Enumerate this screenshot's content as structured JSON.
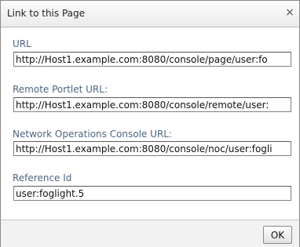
{
  "dialog": {
    "title": "Link to this Page",
    "close_glyph": "×"
  },
  "fields": {
    "url": {
      "label": "URL",
      "value": "http://Host1.example.com:8080/console/page/user:fo"
    },
    "remote_portlet_url": {
      "label": "Remote Portlet URL:",
      "value": "http://Host1.example.com:8080/console/remote/user:"
    },
    "noc_url": {
      "label": "Network Operations Console URL:",
      "value": "http://Host1.example.com:8080/console/noc/user:fogli"
    },
    "reference_id": {
      "label": "Reference Id",
      "value": "user:foglight.5"
    }
  },
  "footer": {
    "ok_label": "OK"
  }
}
